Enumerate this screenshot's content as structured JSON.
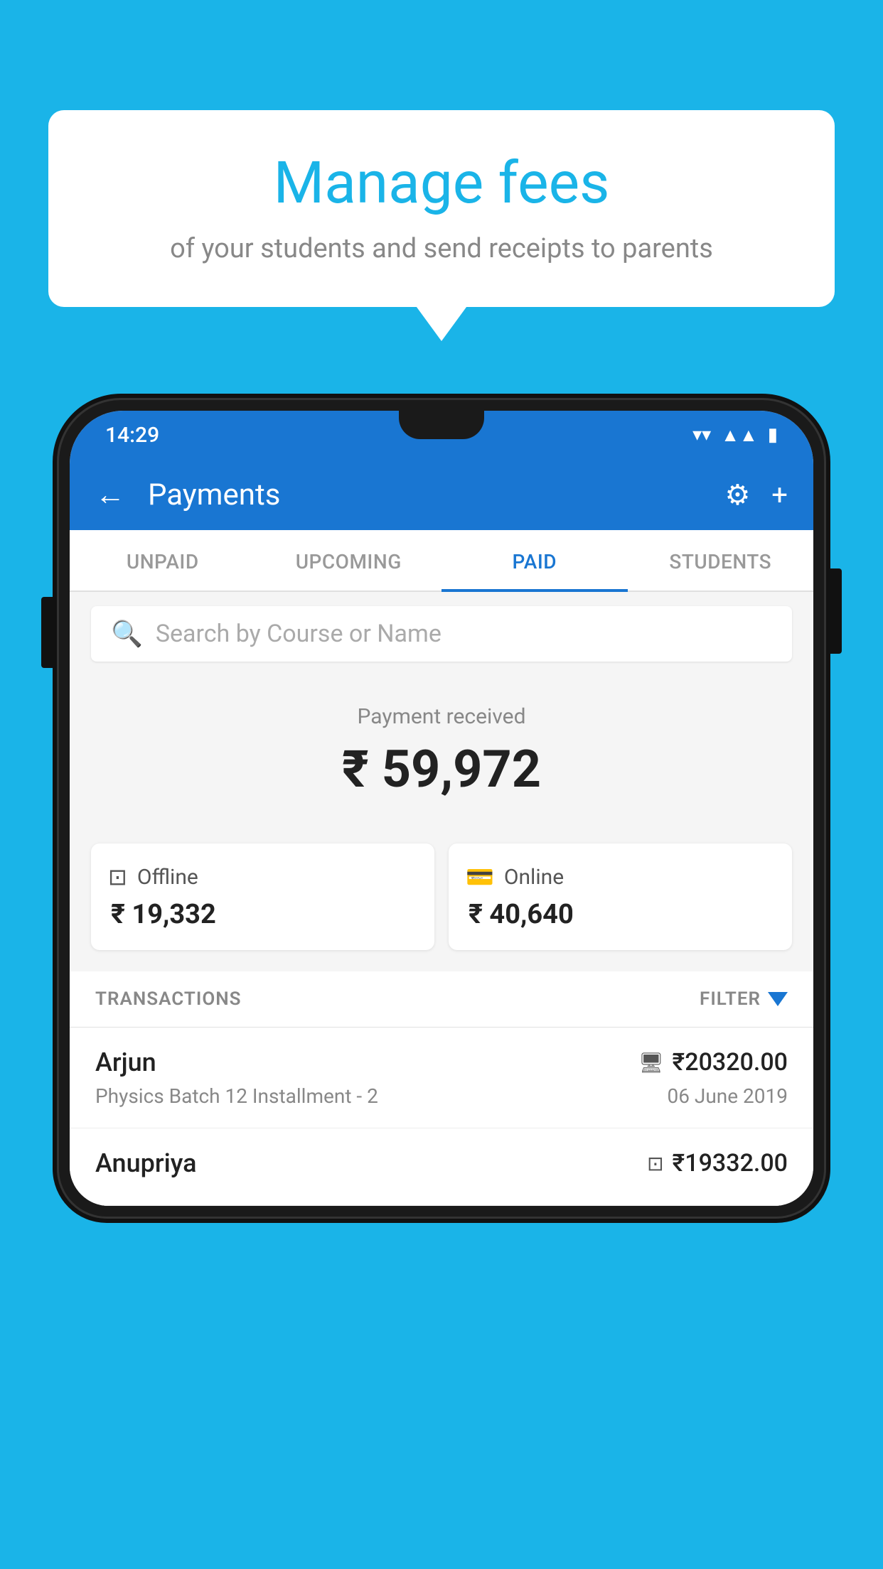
{
  "background_color": "#1ab4e8",
  "speech_bubble": {
    "title": "Manage fees",
    "subtitle": "of your students and send receipts to parents"
  },
  "status_bar": {
    "time": "14:29",
    "wifi_icon": "wifi",
    "signal_icon": "signal",
    "battery_icon": "battery"
  },
  "app_bar": {
    "title": "Payments",
    "back_icon": "←",
    "gear_icon": "⚙",
    "plus_icon": "+"
  },
  "tabs": [
    {
      "label": "UNPAID",
      "active": false
    },
    {
      "label": "UPCOMING",
      "active": false
    },
    {
      "label": "PAID",
      "active": true
    },
    {
      "label": "STUDENTS",
      "active": false
    }
  ],
  "search": {
    "placeholder": "Search by Course or Name"
  },
  "payment_received": {
    "label": "Payment received",
    "amount": "₹ 59,972",
    "offline": {
      "label": "Offline",
      "amount": "₹ 19,332"
    },
    "online": {
      "label": "Online",
      "amount": "₹ 40,640"
    }
  },
  "transactions_section": {
    "label": "TRANSACTIONS",
    "filter_label": "FILTER"
  },
  "transactions": [
    {
      "name": "Arjun",
      "course": "Physics Batch 12 Installment - 2",
      "amount": "₹20320.00",
      "date": "06 June 2019",
      "payment_type": "online"
    },
    {
      "name": "Anupriya",
      "course": "",
      "amount": "₹19332.00",
      "date": "",
      "payment_type": "offline"
    }
  ]
}
